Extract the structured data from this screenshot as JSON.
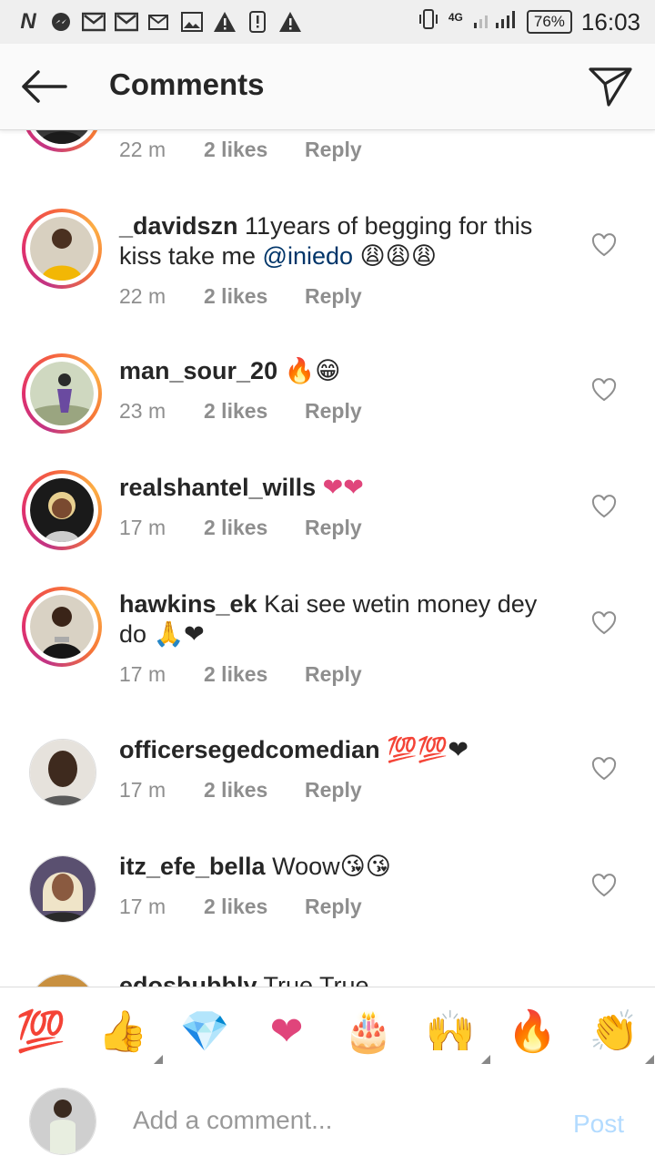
{
  "status_bar": {
    "left_icons": [
      "N",
      "messenger-icon",
      "gmail-icon",
      "gmail-icon",
      "email-icon",
      "gallery-icon",
      "warning-icon",
      "alert-icon",
      "warning-icon"
    ],
    "network": "4G",
    "battery": "76%",
    "time": "16:03"
  },
  "header": {
    "title": "Comments"
  },
  "comments": [
    {
      "user": "",
      "text": "",
      "time": "22 m",
      "likes": "2 likes",
      "reply": "Reply",
      "ring": true
    },
    {
      "user": "_davidszn",
      "text": " 11years of begging for this kiss  take me ",
      "mention": "@iniedo",
      "emoji": " 😩😩😩",
      "time": "22 m",
      "likes": "2 likes",
      "reply": "Reply",
      "ring": true
    },
    {
      "user": "man_sour_20",
      "text": " 🔥😁",
      "time": "23 m",
      "likes": "2 likes",
      "reply": "Reply",
      "ring": true
    },
    {
      "user": "realshantel_wills",
      "text": " ❤❤",
      "time": "17 m",
      "likes": "2 likes",
      "reply": "Reply",
      "ring": true
    },
    {
      "user": "hawkins_ek",
      "text": " Kai see wetin money dey do 🙏❤",
      "time": "17 m",
      "likes": "2 likes",
      "reply": "Reply",
      "ring": true
    },
    {
      "user": "officersegedcomedian",
      "text": " 💯💯❤",
      "time": "17 m",
      "likes": "2 likes",
      "reply": "Reply",
      "ring": false
    },
    {
      "user": "itz_efe_bella",
      "text": " Woow😘😘",
      "time": "17 m",
      "likes": "2 likes",
      "reply": "Reply",
      "ring": false
    },
    {
      "user": "edoshubbly",
      "text": " True True",
      "ring": false
    }
  ],
  "emoji_bar": [
    "💯",
    "👍",
    "💎",
    "❤",
    "🎂",
    "🙌",
    "🔥",
    "👏"
  ],
  "input": {
    "placeholder": "Add a comment...",
    "post_label": "Post"
  },
  "colors": {
    "accent": "#0095f6",
    "post_disabled": "#b3dbff",
    "mention": "#003569"
  }
}
